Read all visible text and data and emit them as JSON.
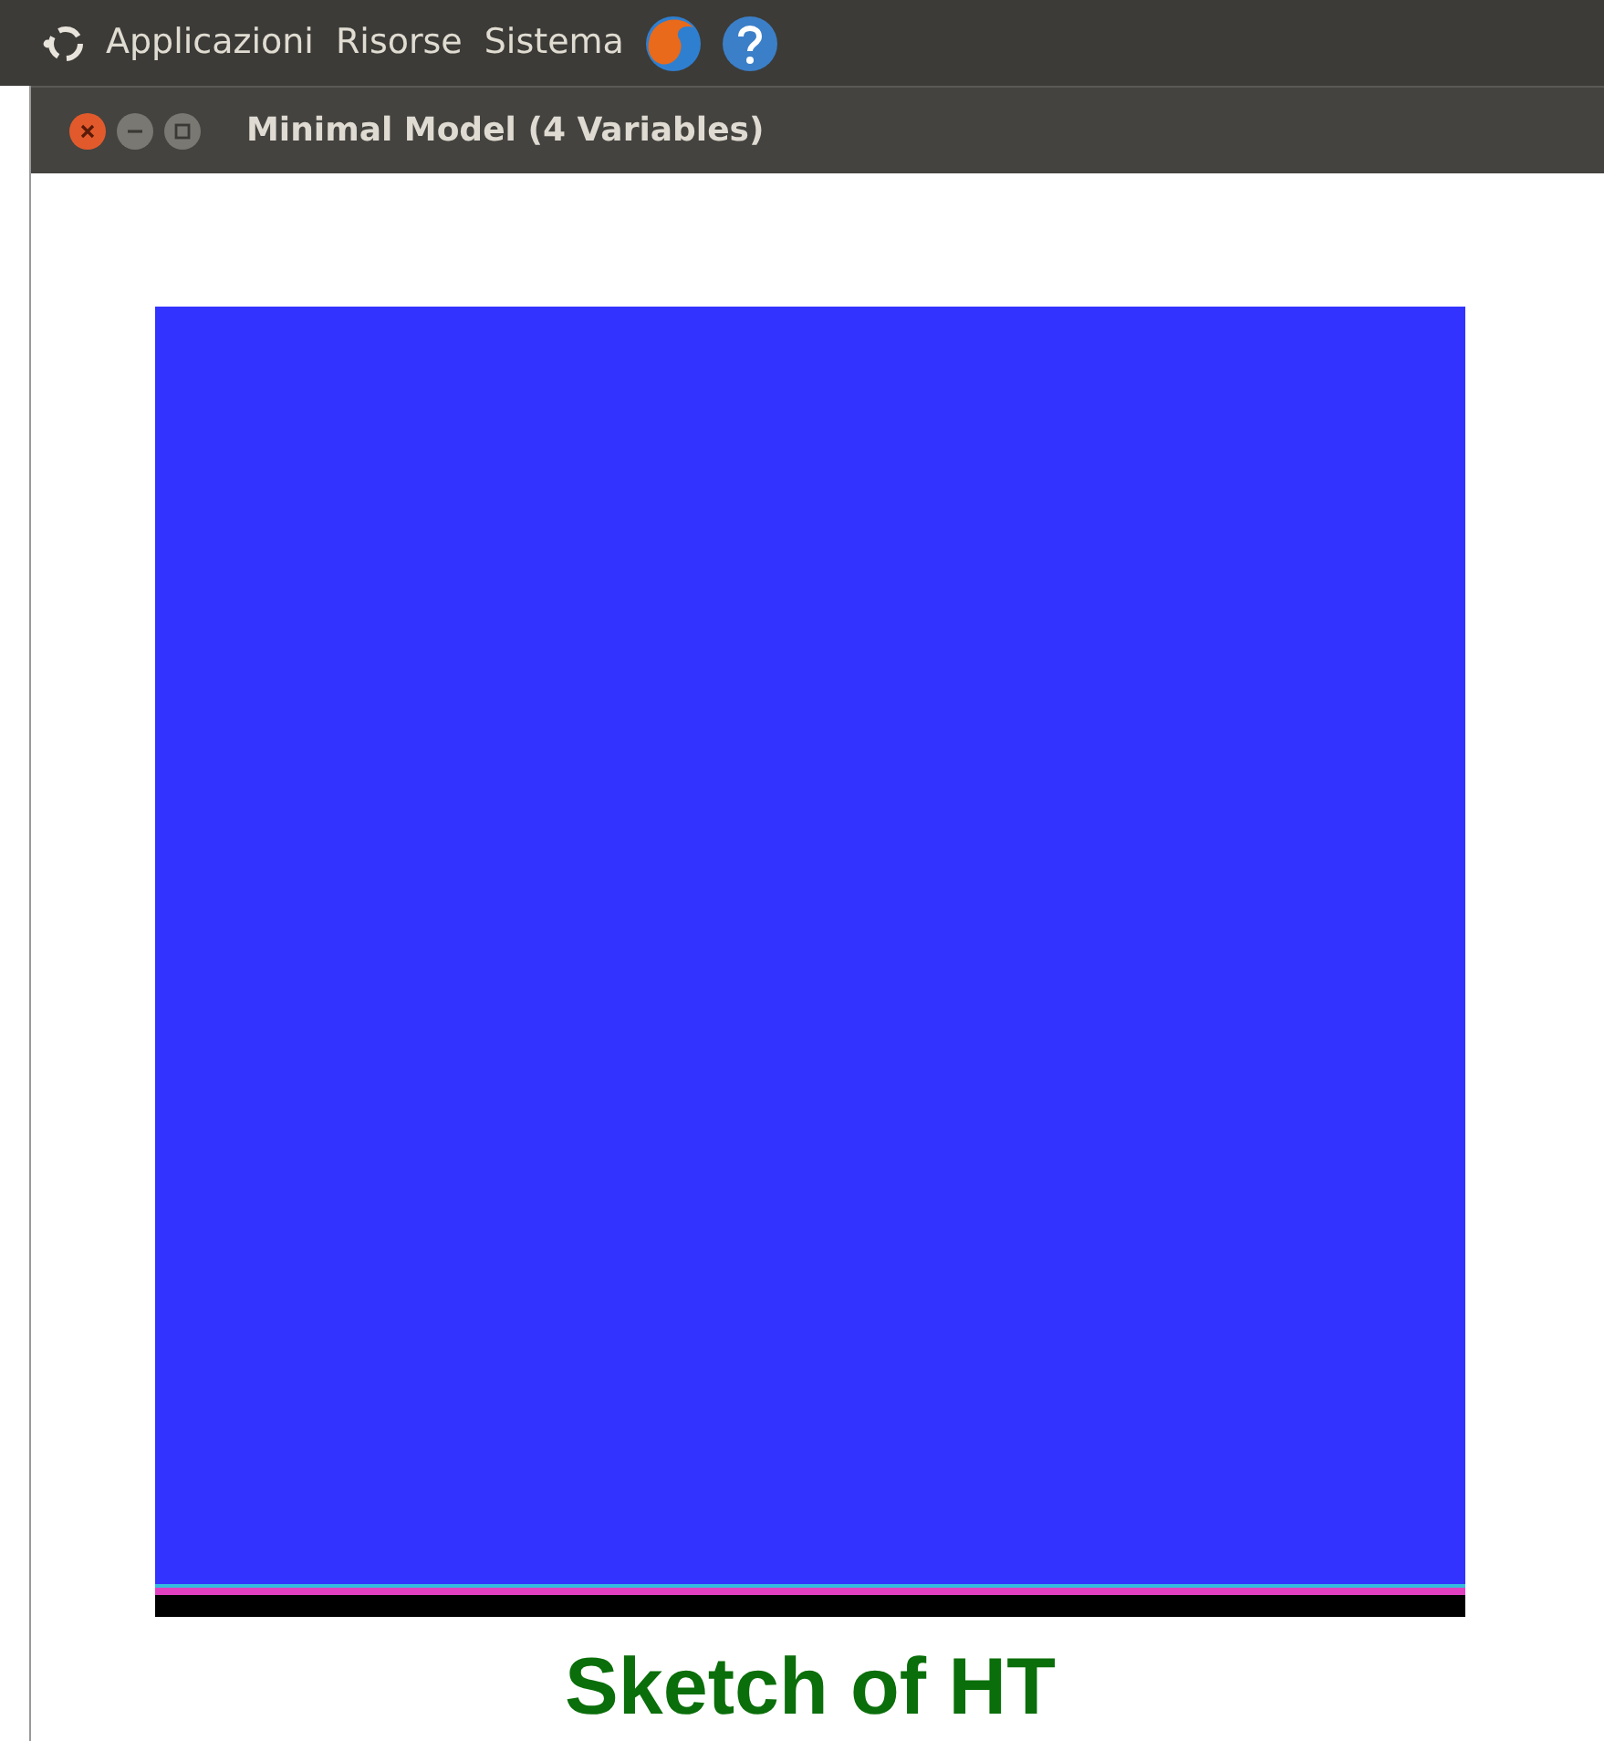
{
  "top_panel": {
    "menus": [
      "Applicazioni",
      "Risorse",
      "Sistema"
    ]
  },
  "window": {
    "title": "Minimal Model (4 Variables)"
  },
  "heading": "Sketch of HT"
}
